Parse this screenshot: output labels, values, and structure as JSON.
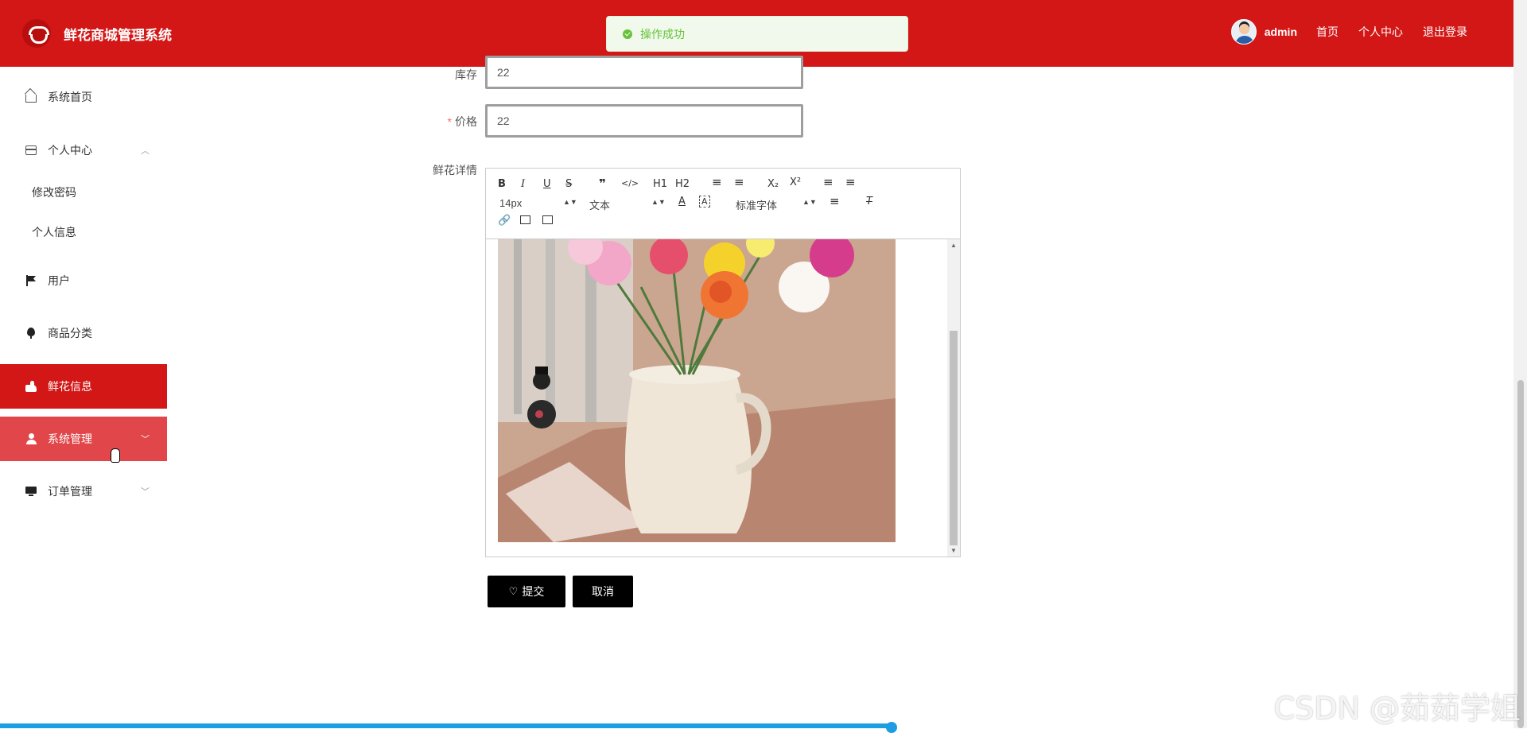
{
  "header": {
    "app_title": "鲜花商城管理系统",
    "logo_icon": "flower-logo-icon",
    "user_name": "admin",
    "nav": [
      "首页",
      "个人中心",
      "退出登录"
    ],
    "accent_color": "#d31616"
  },
  "toast": {
    "message": "操作成功",
    "type": "success"
  },
  "sidebar": {
    "items": [
      {
        "label": "系统首页",
        "icon": "home-icon"
      },
      {
        "label": "个人中心",
        "icon": "card-icon",
        "expanded": true,
        "children": [
          "修改密码",
          "个人信息"
        ]
      },
      {
        "label": "用户",
        "icon": "flag-icon"
      },
      {
        "label": "商品分类",
        "icon": "balloon-icon"
      },
      {
        "label": "鲜花信息",
        "icon": "hand-icon",
        "state": "active"
      },
      {
        "label": "系统管理",
        "icon": "user-icon",
        "state": "hover",
        "expanded": false
      },
      {
        "label": "订单管理",
        "icon": "monitor-icon",
        "expanded": false
      }
    ]
  },
  "form": {
    "stock": {
      "label": "库存",
      "value": "22"
    },
    "price": {
      "label": "价格",
      "value": "22",
      "required": true
    },
    "details": {
      "label": "鲜花详情"
    },
    "editor": {
      "toolbar_row1": [
        "B",
        "I",
        "U",
        "S",
        "❞",
        "</>",
        "H1",
        "H2",
        "ordered-list",
        "bullet-list",
        "X₂",
        "X²",
        "outdent",
        "indent"
      ],
      "font_size": "14px",
      "header_select": "文本",
      "font_family": "标准字体",
      "content_image": "flowers-in-white-pitcher-image"
    },
    "submit_label": "提交",
    "cancel_label": "取消"
  },
  "player": {
    "progress": 0.584
  },
  "watermark": "CSDN @茹茹学姐"
}
